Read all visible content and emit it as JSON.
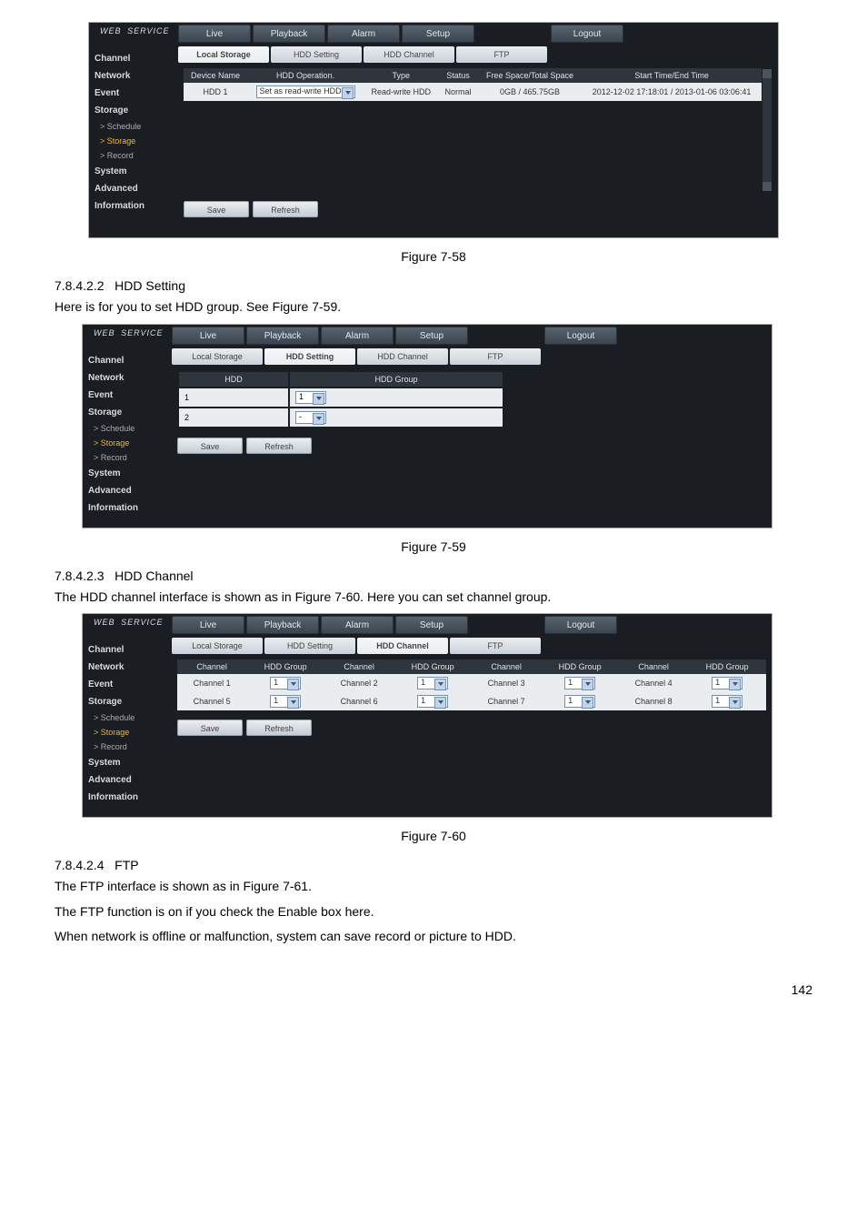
{
  "brand": "WEB",
  "brand_sub": "SERVICE",
  "header_tabs": {
    "live": "Live",
    "playback": "Playback",
    "alarm": "Alarm",
    "setup": "Setup",
    "logout": "Logout"
  },
  "sidebar": {
    "channel": "Channel",
    "network": "Network",
    "event": "Event",
    "storage": "Storage",
    "schedule": "Schedule",
    "storage_sub": "Storage",
    "record": "Record",
    "system": "System",
    "advanced": "Advanced",
    "information": "Information"
  },
  "sub_tabs": {
    "local_storage": "Local Storage",
    "hdd_setting": "HDD Setting",
    "hdd_channel": "HDD Channel",
    "ftp": "FTP"
  },
  "buttons": {
    "save": "Save",
    "refresh": "Refresh"
  },
  "shot1": {
    "th": {
      "device_name": "Device Name",
      "hdd_operation": "HDD Operation.",
      "type": "Type",
      "status": "Status",
      "free_total": "Free Space/Total Space",
      "start_end": "Start Time/End Time"
    },
    "row": {
      "device_name": "HDD 1",
      "hdd_operation": "Set as read-write HDD",
      "type": "Read-write HDD",
      "status": "Normal",
      "free_total": "0GB / 465.75GB",
      "start_end": "2012-12-02 17:18:01 / 2013-01-06 03:06:41"
    }
  },
  "shot2": {
    "th": {
      "hdd": "HDD",
      "hdd_group": "HDD Group"
    },
    "rows": [
      {
        "hdd": "1",
        "group": "1"
      },
      {
        "hdd": "2",
        "group": "-"
      }
    ]
  },
  "shot3": {
    "th": {
      "channel": "Channel",
      "hdd_group": "HDD Group"
    },
    "rows": [
      {
        "c1": "Channel 1",
        "g1": "1",
        "c2": "Channel 2",
        "g2": "1",
        "c3": "Channel 3",
        "g3": "1",
        "c4": "Channel 4",
        "g4": "1"
      },
      {
        "c1": "Channel 5",
        "g1": "1",
        "c2": "Channel 6",
        "g2": "1",
        "c3": "Channel 7",
        "g3": "1",
        "c4": "Channel 8",
        "g4": "1"
      }
    ]
  },
  "captions": {
    "fig58": "Figure 7-58",
    "fig59": "Figure 7-59",
    "fig60": "Figure 7-60"
  },
  "sections": {
    "hdd_setting_num": "7.8.4.2.2",
    "hdd_setting_title": "HDD Setting",
    "hdd_setting_text": "Here is for you to set HDD group. See Figure 7-59.",
    "hdd_channel_num": "7.8.4.2.3",
    "hdd_channel_title": "HDD Channel",
    "hdd_channel_text": "The HDD channel interface is shown as in Figure 7-60. Here you can set channel group.",
    "ftp_num": "7.8.4.2.4",
    "ftp_title": "FTP",
    "ftp_line1": "The FTP interface is shown as in Figure 7-61.",
    "ftp_line2": "The FTP function is on if you check the Enable box here.",
    "ftp_line3": "When network is offline or malfunction, system can save record or picture to HDD."
  },
  "page_number": "142"
}
